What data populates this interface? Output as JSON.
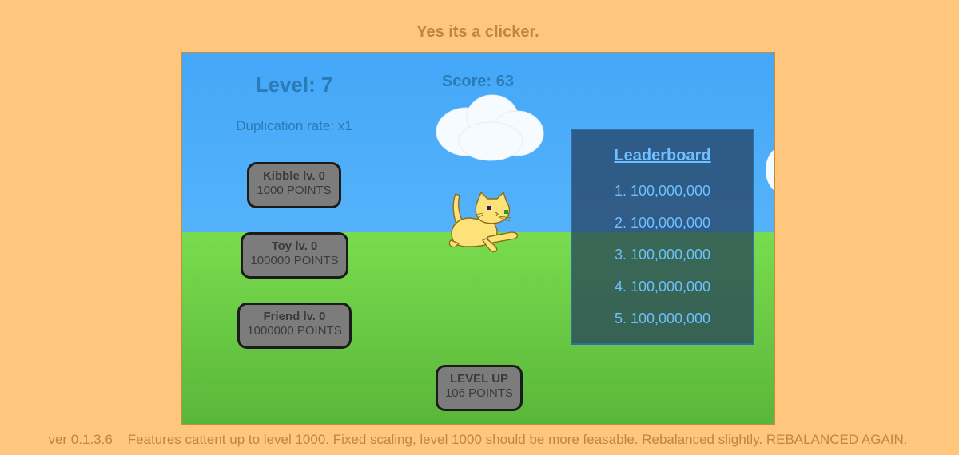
{
  "page": {
    "title": "Yes its a clicker.",
    "footer": "ver 0.1.3.6    Features cattent up to level 1000. Fixed scaling, level 1000 should be more feasable. Rebalanced slightly. REBALANCED AGAIN."
  },
  "game": {
    "level_label": "Level: 7",
    "score_label": "Score: 63",
    "duplication_rate": "Duplication rate: x1",
    "upgrades": [
      {
        "name": "Kibble lv. 0",
        "cost": "1000 POINTS"
      },
      {
        "name": "Toy lv. 0",
        "cost": "100000 POINTS"
      },
      {
        "name": "Friend lv. 0",
        "cost": "1000000 POINTS"
      }
    ],
    "level_up": {
      "name": "LEVEL UP",
      "cost": "106 POINTS"
    },
    "leaderboard": {
      "title": "Leaderboard",
      "entries": [
        "1. 100,000,000",
        "2. 100,000,000",
        "3. 100,000,000",
        "4. 100,000,000",
        "5. 100,000,000"
      ]
    }
  },
  "colors": {
    "page_background": "#ffc77e",
    "title_text": "#c2853f",
    "sky": "#44a7f8",
    "grass": "#79dc4e",
    "hud_text": "#2a7cb6",
    "button_fill": "#7c7c7c",
    "leaderboard_text": "#6ec0ff",
    "cat_body": "#fde27a"
  },
  "icons": {
    "cat": "cat-sprite",
    "cloud": "cloud-shape"
  }
}
